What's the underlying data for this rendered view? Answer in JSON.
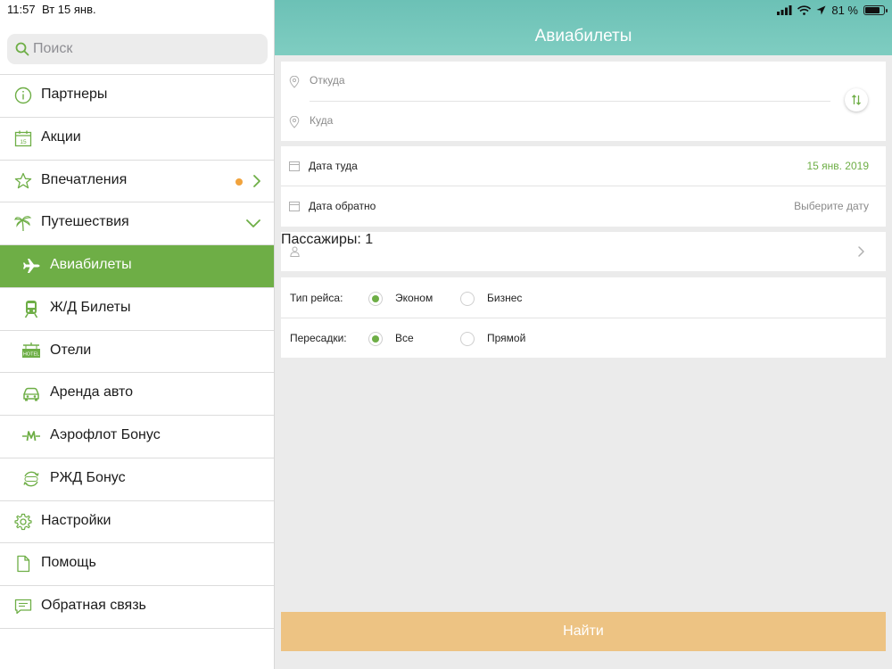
{
  "status_bar": {
    "time": "11:57",
    "date": "Вт 15 янв.",
    "battery_percent": "81 %",
    "battery_level": 0.81
  },
  "sidebar": {
    "search_placeholder": "Поиск",
    "items": [
      {
        "label": "Партнеры",
        "icon": "info-icon"
      },
      {
        "label": "Акции",
        "icon": "calendar-icon"
      },
      {
        "label": "Впечатления",
        "icon": "star-icon",
        "has_dot": true
      },
      {
        "label": "Путешествия",
        "icon": "palm-tree-icon",
        "expanded": true
      },
      {
        "label": "Авиабилеты",
        "icon": "airplane-icon",
        "active": true
      },
      {
        "label": "Ж/Д Билеты",
        "icon": "train-icon"
      },
      {
        "label": "Отели",
        "icon": "hotel-sign-icon"
      },
      {
        "label": "Аренда авто",
        "icon": "car-icon"
      },
      {
        "label": "Аэрофлот Бонус",
        "icon": "aeroflot-bonus-icon"
      },
      {
        "label": "РЖД Бонус",
        "icon": "rzd-bonus-icon"
      },
      {
        "label": "Настройки",
        "icon": "gear-icon"
      },
      {
        "label": "Помощь",
        "icon": "document-icon"
      },
      {
        "label": "Обратная связь",
        "icon": "chat-icon"
      }
    ]
  },
  "main": {
    "title": "Авиабилеты",
    "route": {
      "from_placeholder": "Откуда",
      "to_placeholder": "Куда"
    },
    "dates": {
      "depart_label": "Дата туда",
      "depart_value": "15 янв. 2019",
      "return_label": "Дата обратно",
      "return_value": "Выберите дату"
    },
    "passengers_label": "Пассажиры: 1",
    "options": {
      "class_label": "Тип рейса:",
      "class_options": [
        "Эконом",
        "Бизнес"
      ],
      "class_selected": "Эконом",
      "transfers_label": "Пересадки:",
      "transfers_options": [
        "Все",
        "Прямой"
      ],
      "transfers_selected": "Все"
    },
    "search_button": "Найти"
  },
  "colors": {
    "accent_green": "#6eae46",
    "header_teal": "#79c9bd",
    "dot_orange": "#f1a33d",
    "search_button": "#edc383"
  }
}
